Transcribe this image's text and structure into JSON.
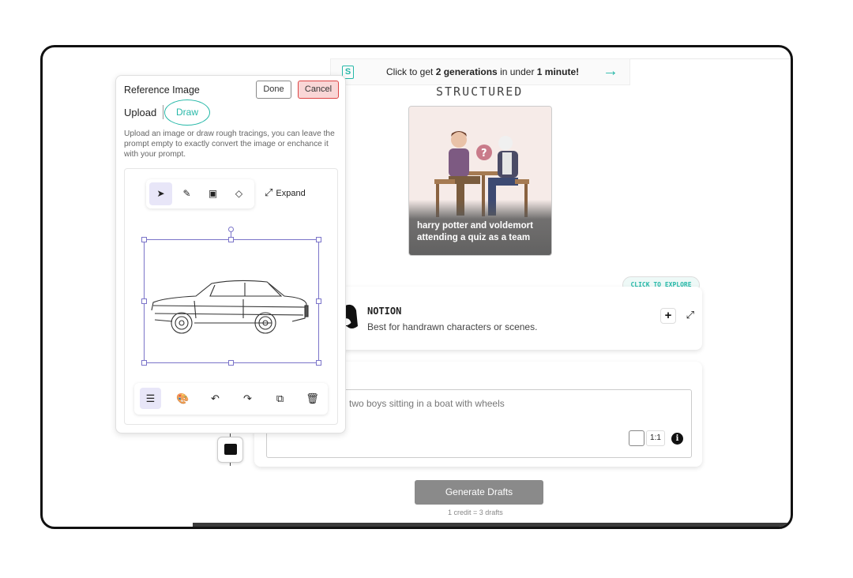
{
  "promo": {
    "text_prefix": "Click to get ",
    "bold1": "2 generations",
    "text_mid": " in under ",
    "bold2": "1 minute!",
    "arrow": "→",
    "coin_label": "S"
  },
  "style": {
    "title": "STRUCTURED",
    "card_caption": "harry potter and voldemort attending a quiz as a team"
  },
  "model": {
    "explore_label": "CLICK TO EXPLORE",
    "name": "NOTION",
    "description": "Best for handrawn characters or scenes.",
    "add_label": "+",
    "expand_label": "⤢"
  },
  "prompt": {
    "placeholder": "two boys sitting in a boat with wheels",
    "ratio": "1:1",
    "info": "i"
  },
  "generate": {
    "button_label": "Generate Drafts",
    "credit_text": "1 credit = 3 drafts"
  },
  "reference_panel": {
    "title": "Reference Image",
    "done_label": "Done",
    "cancel_label": "Cancel",
    "tab_upload": "Upload",
    "tab_draw": "Draw",
    "help_text": "Upload an image or draw rough tracings, you can leave the prompt empty to exactly convert the image or enchance it with your prompt.",
    "expand_label": "Expand",
    "tools": [
      {
        "icon": "select-arrow-icon",
        "glyph": "➤",
        "active": true
      },
      {
        "icon": "pencil-icon",
        "glyph": "✎",
        "active": false
      },
      {
        "icon": "image-icon",
        "glyph": "▣",
        "active": false
      },
      {
        "icon": "eraser-icon",
        "glyph": "◇",
        "active": false
      }
    ],
    "bottom_tools": [
      {
        "icon": "menu-icon",
        "glyph": "☰",
        "active": true
      },
      {
        "icon": "palette-icon",
        "glyph": "🎨",
        "active": false
      },
      {
        "icon": "undo-icon",
        "glyph": "↶",
        "active": false
      },
      {
        "icon": "redo-icon",
        "glyph": "↷",
        "active": false
      },
      {
        "icon": "duplicate-icon",
        "glyph": "⧉",
        "active": false
      },
      {
        "icon": "trash-icon",
        "glyph": "🗑",
        "active": false
      }
    ]
  },
  "colors": {
    "accent": "#26b8a8",
    "selection": "#7b74c9",
    "cancel_bg": "#f9d6d6",
    "button_gray": "#8a8a8a"
  }
}
